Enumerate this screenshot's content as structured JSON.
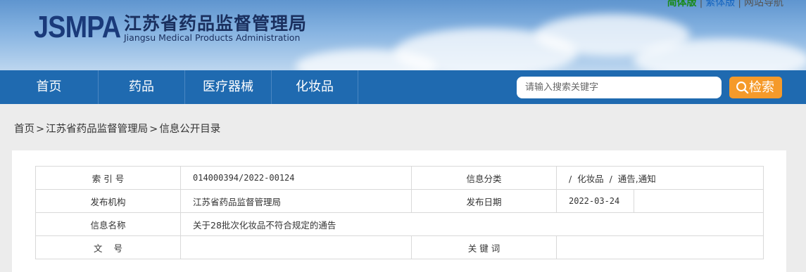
{
  "header": {
    "logo_mark": "JSMPA",
    "logo_cn": "江苏省药品监督管理局",
    "logo_en": "Jiangsu Medical Products Administration",
    "links": [
      {
        "label": "简体版"
      },
      {
        "label": "繁体版"
      },
      {
        "label": "网站导航"
      }
    ],
    "separator": "|"
  },
  "nav": {
    "items": [
      {
        "label": "首页"
      },
      {
        "label": "药品"
      },
      {
        "label": "医疗器械"
      },
      {
        "label": "化妆品"
      }
    ],
    "search_placeholder": "请输入搜索关键字",
    "search_button": "检索"
  },
  "breadcrumb": {
    "items": [
      {
        "label": "首页"
      },
      {
        "label": "江苏省药品监督管理局"
      },
      {
        "label": "信息公开目录"
      }
    ],
    "separator": ">"
  },
  "info_table": {
    "rows": [
      {
        "label1": "索 引 号",
        "value1": "014000394/2022-00124",
        "label2": "信息分类",
        "value2": "/  化妆品  /  通告,通知"
      },
      {
        "label1": "发布机构",
        "value1": "江苏省药品监督管理局",
        "label2": "发布日期",
        "value2": "2022-03-24"
      },
      {
        "label1": "信息名称",
        "value1": "关于28批次化妆品不符合规定的通告"
      },
      {
        "label1": "文    号",
        "value1": "",
        "label2": "关 键 词",
        "value2": ""
      }
    ]
  },
  "colors": {
    "nav_bg": "#1f6ab0",
    "search_button_bg": "#f59a2a",
    "logo_text": "#1a3a7a"
  }
}
